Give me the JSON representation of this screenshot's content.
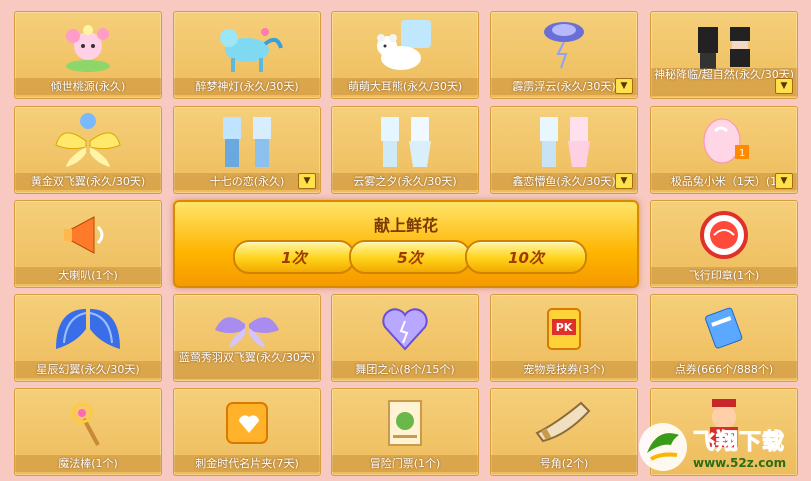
{
  "items": [
    {
      "label": "倾世桃源(永久)",
      "icon": "flower-fairy-icon"
    },
    {
      "label": "醉梦神灯(永久/30天)",
      "icon": "pony-lamp-icon"
    },
    {
      "label": "萌萌大耳熊(永久/30天)",
      "icon": "white-bear-icon"
    },
    {
      "label": "霹雳浮云(永久/30天)",
      "icon": "thunder-cloud-icon",
      "dropdown": true
    },
    {
      "label": "神秘降临/超自然(永久/30天)",
      "icon": "dark-outfit-icon",
      "dropdown": true
    },
    {
      "label": "黄金双飞翼(永久/30天)",
      "icon": "golden-wings-icon"
    },
    {
      "label": "十七の恋(永久)",
      "icon": "couple-outfit-icon",
      "dropdown": true
    },
    {
      "label": "云雾之夕(永久/30天)",
      "icon": "mist-outfit-icon"
    },
    {
      "label": "鑫恋懵鱼(永久/30天)",
      "icon": "pink-outfit-icon",
      "dropdown": true
    },
    {
      "label": "极品兔小米（1天）(1",
      "icon": "bunny-egg-icon",
      "dropdown": true
    },
    {
      "label": "大喇叭(1个)",
      "icon": "megaphone-icon"
    },
    {
      "label": "飞行印章(1个)",
      "icon": "fly-stamp-icon"
    },
    {
      "label": "星辰幻翼(永久/30天)",
      "icon": "blue-wings-icon"
    },
    {
      "label": "蓝莺秀羽双飞翼(永久/30天)",
      "icon": "purple-wings-icon"
    },
    {
      "label": "舞团之心(8个/15个)",
      "icon": "heart-icon"
    },
    {
      "label": "宠物竞技券(3个)",
      "icon": "pk-ticket-icon"
    },
    {
      "label": "点券(666个/888个)",
      "icon": "coupon-icon"
    },
    {
      "label": "魔法棒(1个)",
      "icon": "magic-wand-icon"
    },
    {
      "label": "刺金时代名片夹(7天)",
      "icon": "card-holder-icon"
    },
    {
      "label": "冒险门票(1个)",
      "icon": "scroll-ticket-icon"
    },
    {
      "label": "号角(2个)",
      "icon": "horn-icon"
    },
    {
      "label": "",
      "icon": "fortune-god-icon"
    }
  ],
  "panel": {
    "title": "献上鲜花",
    "buttons": [
      "1次",
      "5次",
      "10次"
    ]
  },
  "watermark": {
    "cn": "飞翔下载",
    "url": "www.52z.com"
  }
}
